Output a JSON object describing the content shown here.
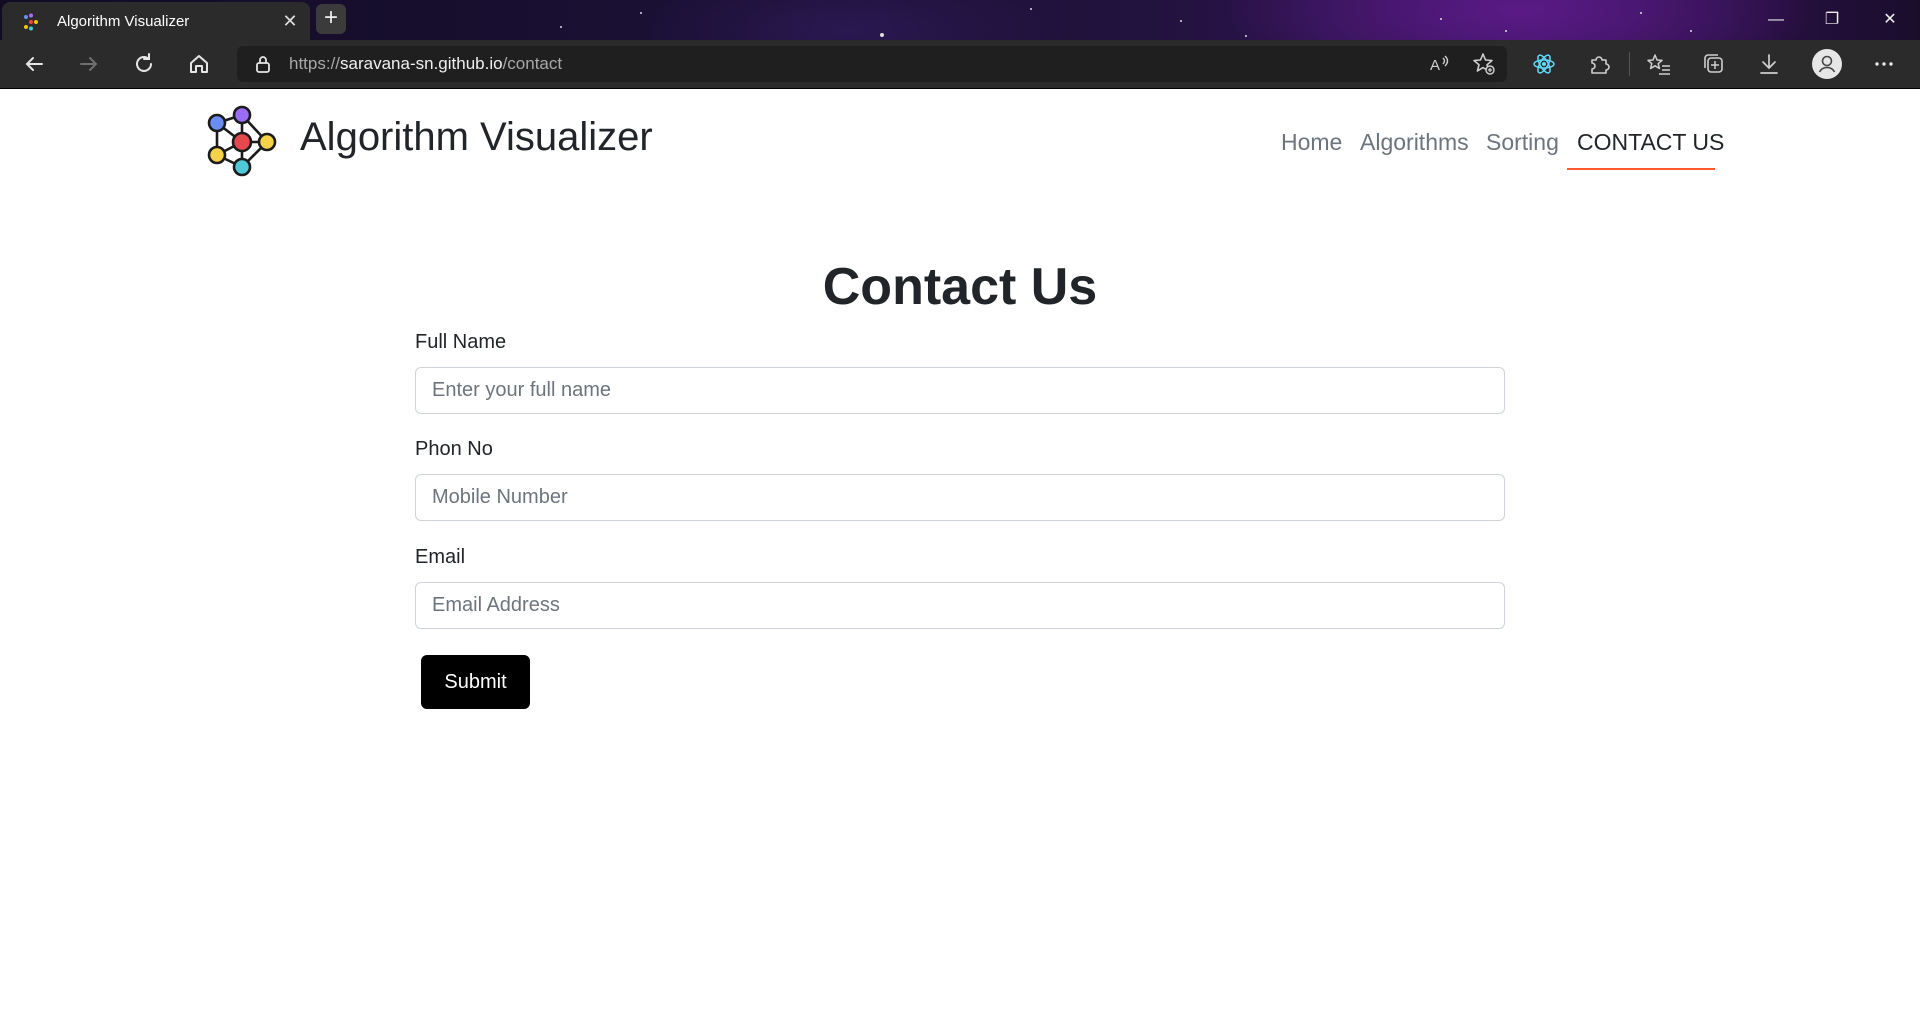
{
  "browser": {
    "tab_title": "Algorithm Visualizer",
    "tab_close": "✕",
    "new_tab": "+",
    "url_scheme": "https://",
    "url_host": "saravana-sn.github.io",
    "url_path": "/contact",
    "window_controls": {
      "minimize": "—",
      "restore": "❐",
      "close": "✕"
    },
    "toolbar_icons": [
      "back-icon",
      "forward-icon",
      "refresh-icon",
      "home-icon",
      "read-aloud-icon",
      "add-favorite-icon",
      "react-devtools-icon",
      "extensions-icon",
      "favorites-icon",
      "collections-icon",
      "downloads-icon",
      "profile-icon",
      "more-icon"
    ]
  },
  "header": {
    "brand": "Algorithm Visualizer",
    "nav": {
      "home": "Home",
      "algorithms": "Algorithms",
      "sorting": "Sorting",
      "contact": "CONTACT US"
    },
    "active_nav": "contact",
    "accent_color": "#ff5a2e"
  },
  "form": {
    "heading": "Contact Us",
    "full_name_label": "Full Name",
    "full_name_placeholder": "Enter your full name",
    "phone_label": "Phon No",
    "phone_placeholder": "Mobile Number",
    "email_label": "Email",
    "email_placeholder": "Email Address",
    "submit_label": "Submit"
  }
}
